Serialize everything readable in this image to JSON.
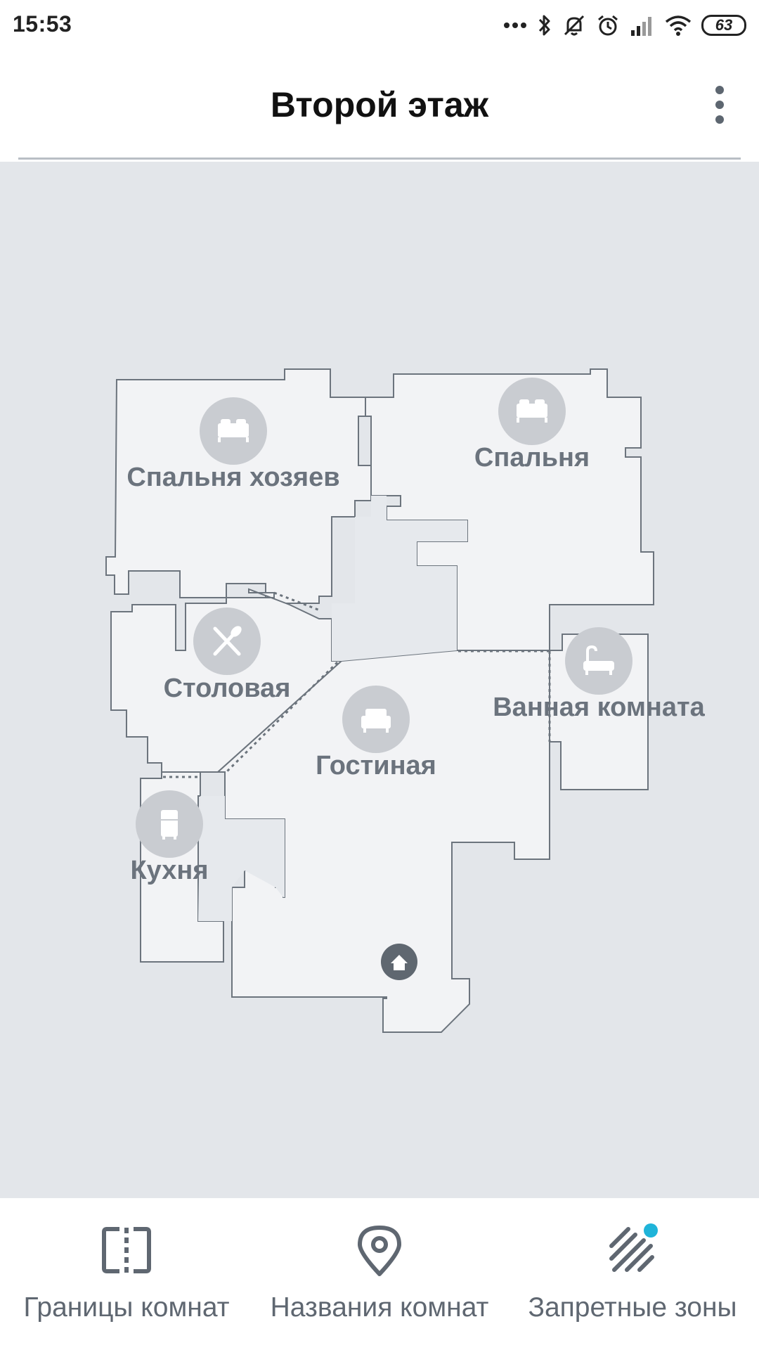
{
  "status_bar": {
    "time": "15:53",
    "battery": "63",
    "icons": [
      "dots-icon",
      "bluetooth-icon",
      "mute-icon",
      "alarm-icon",
      "signal-icon",
      "wifi-icon",
      "battery-icon"
    ]
  },
  "header": {
    "title": "Второй этаж",
    "menu_icon": "more-vertical-icon"
  },
  "map": {
    "rooms": [
      {
        "name": "Спальня хозяев",
        "icon": "bed-icon"
      },
      {
        "name": "Спальня",
        "icon": "bed-icon"
      },
      {
        "name": "Столовая",
        "icon": "cutlery-icon"
      },
      {
        "name": "Ванная комната",
        "icon": "bathtub-icon"
      },
      {
        "name": "Гостиная",
        "icon": "armchair-icon"
      },
      {
        "name": "Кухня",
        "icon": "fridge-icon"
      }
    ],
    "dock_icon": "home-icon",
    "colors": {
      "background": "#e3e6ea",
      "floor": "#f2f3f5",
      "wall": "#6c747d",
      "badge": "#c9ccd1",
      "label": "#6b737d"
    }
  },
  "bottom_nav": {
    "items": [
      {
        "label": "Границы комнат",
        "icon": "room-divider-icon"
      },
      {
        "label": "Названия комнат",
        "icon": "location-pin-icon"
      },
      {
        "label": "Запретные зоны",
        "icon": "no-go-zone-icon",
        "badge_color": "#1fb4d9"
      }
    ]
  }
}
